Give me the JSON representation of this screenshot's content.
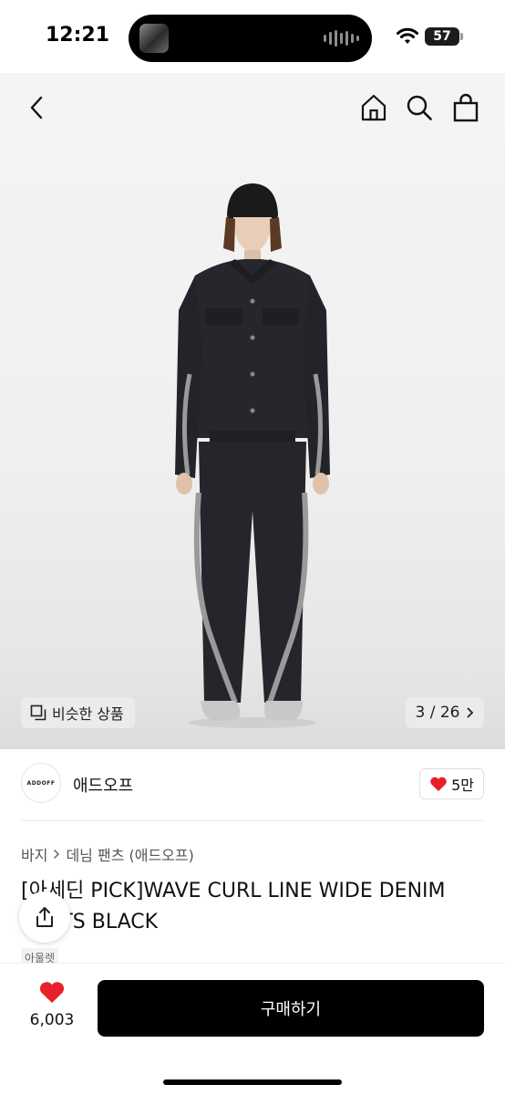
{
  "status": {
    "time": "12:21",
    "battery": "57"
  },
  "nav": {
    "back": "back",
    "home": "home",
    "search": "search",
    "cart": "shopping-bag"
  },
  "hero": {
    "similar_label": "비슷한 상품",
    "pager_current": "3",
    "pager_total": "26",
    "pager_text": "3 / 26"
  },
  "brand": {
    "logo_text": "ADDOFF",
    "name": "애드오프",
    "likes": "5만"
  },
  "breadcrumb": [
    "바지",
    "데님 팬츠 (애드오프)"
  ],
  "product": {
    "title": "[아세딘 PICK]WAVE CURL LINE WIDE DENIM PANTS BLACK",
    "tag": "아울렛"
  },
  "bottom": {
    "wish_count": "6,003",
    "buy_label": "구매하기"
  },
  "colors": {
    "accent": "#e8202a",
    "buy": "#000000"
  }
}
